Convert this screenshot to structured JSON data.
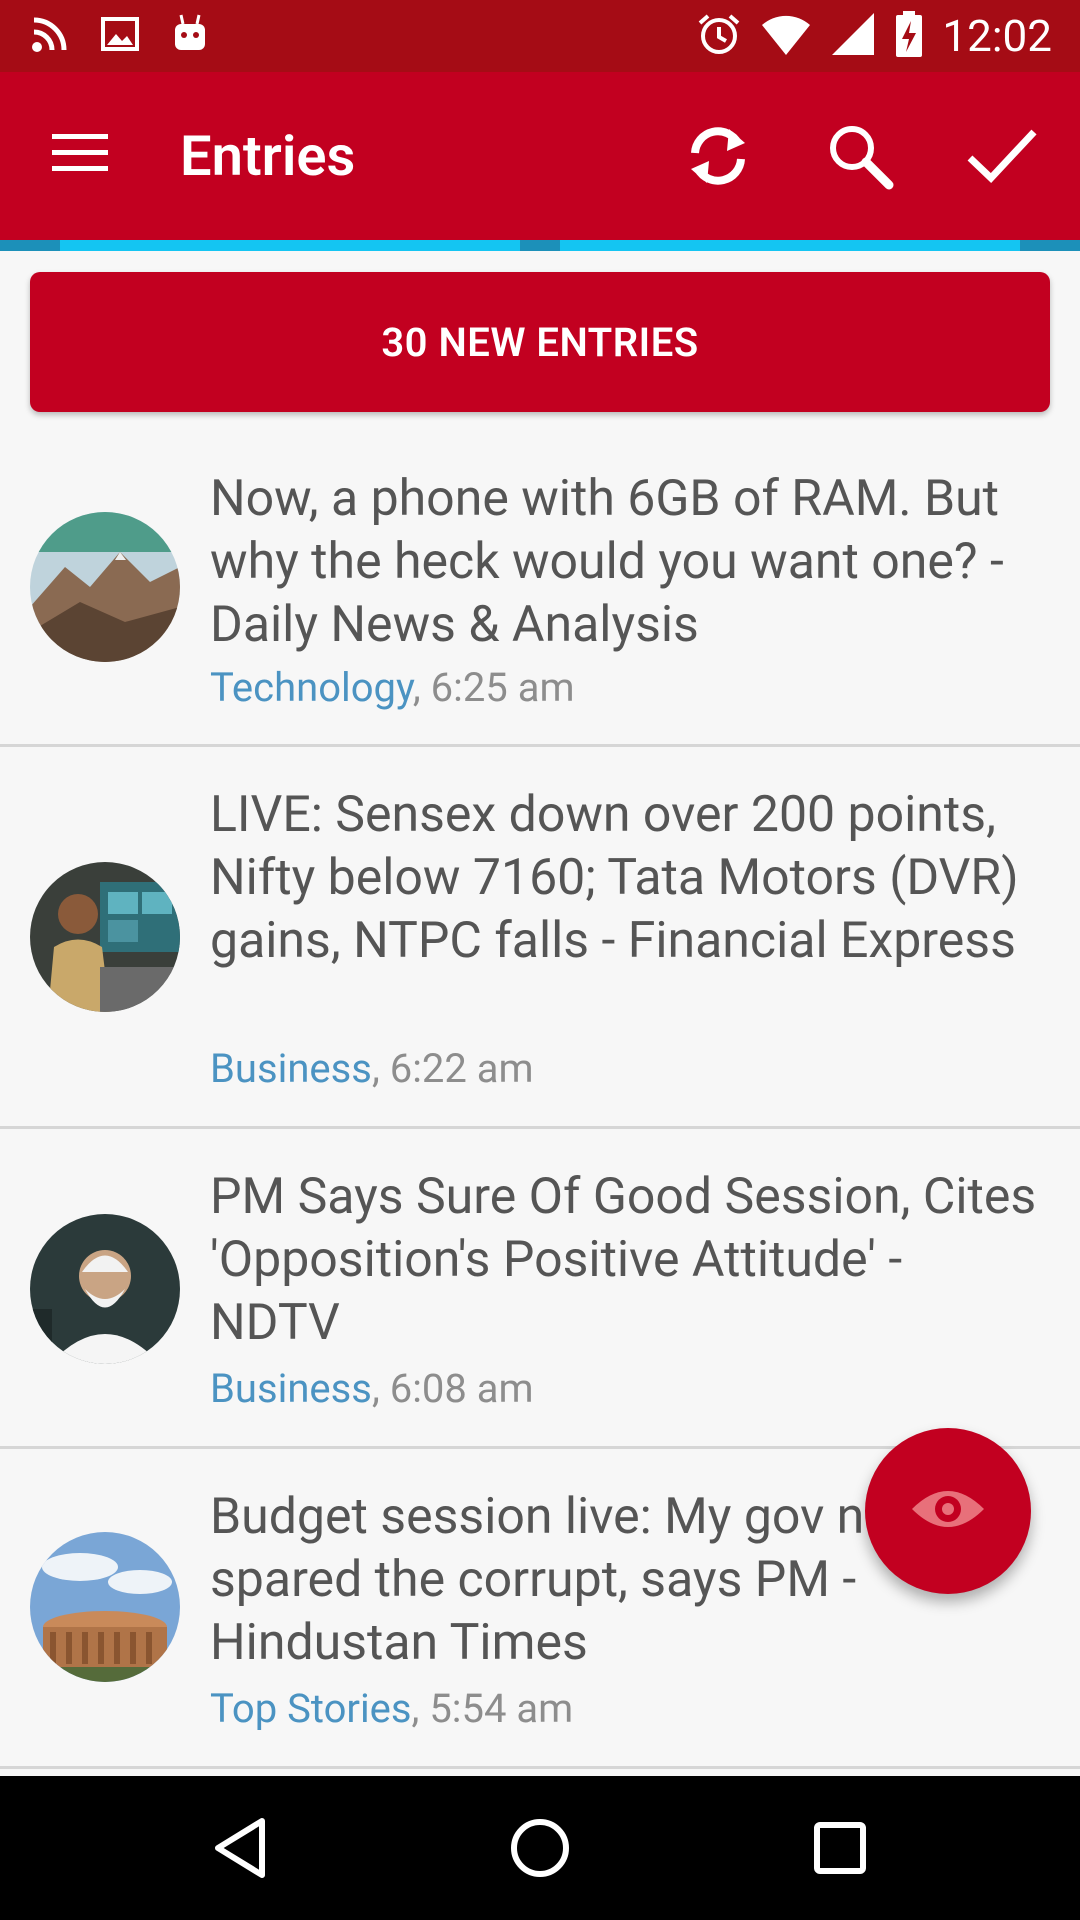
{
  "status_bar": {
    "time": "12:02",
    "left_icons": [
      "rss-icon",
      "image-icon",
      "android-icon"
    ],
    "right_icons": [
      "alarm-icon",
      "wifi-icon",
      "signal-icon",
      "battery-charging-icon"
    ]
  },
  "toolbar": {
    "title": "Entries",
    "icons": [
      "menu-icon",
      "refresh-icon",
      "search-icon",
      "check-icon"
    ]
  },
  "banner": {
    "label": "30 NEW ENTRIES"
  },
  "entries": [
    {
      "title": "Now, a phone with 6GB of RAM. But why the heck would you want one? - Daily News & Analysis",
      "category": "Technology",
      "time": ", 6:25 am"
    },
    {
      "title": "LIVE: Sensex down over 200 points, Nifty below 7160; Tata Motors (DVR) gains, NTPC falls - Financial Express",
      "category": "Business",
      "time": ", 6:22 am"
    },
    {
      "title": "PM Says Sure Of Good Session, Cites 'Opposition's Positive Attitude' - NDTV",
      "category": "Business",
      "time": ", 6:08 am"
    },
    {
      "title": "Budget session live: My gov not spared the corrupt, says PM - Hindustan Times",
      "category": "Top Stories",
      "time": ", 5:54 am"
    }
  ],
  "fab": {
    "icon": "eye-icon"
  },
  "nav_bar": {
    "icons": [
      "back-icon",
      "home-icon",
      "recents-icon"
    ]
  },
  "colors": {
    "status_bar": "#a50c15",
    "primary": "#c20020",
    "accent": "#14c5f2",
    "category_link": "#4b93c2"
  }
}
